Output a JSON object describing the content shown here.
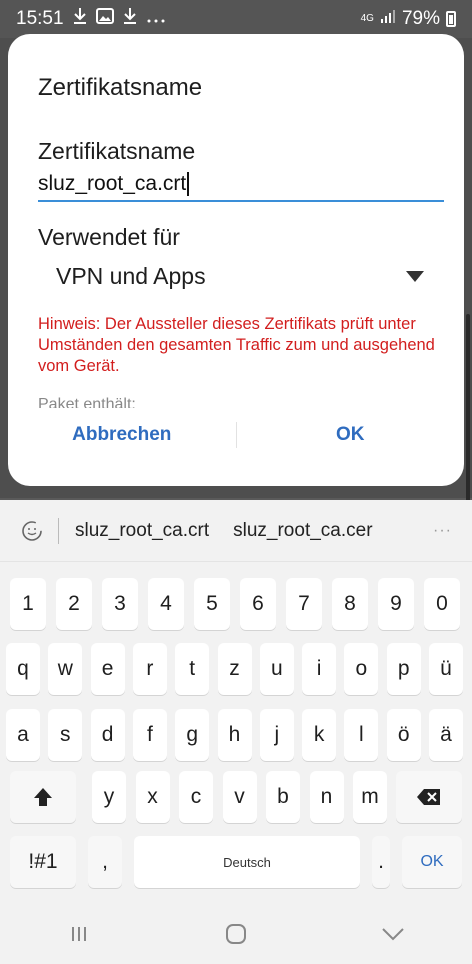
{
  "status_bar": {
    "time": "15:51",
    "network": "4G",
    "battery": "79%"
  },
  "dialog": {
    "title": "Zertifikatsname",
    "name_label": "Zertifikatsname",
    "name_value": "sluz_root_ca.crt",
    "used_for_label": "Verwendet für",
    "used_for_value": "VPN und Apps",
    "warning": "Hinweis: Der Aussteller dieses Zertifikats prüft unter Umständen den gesamten Traffic zum und ausgehend vom Gerät.",
    "package_label": "Paket enthält:",
    "cancel_label": "Abbrechen",
    "ok_label": "OK"
  },
  "keyboard": {
    "suggestions": [
      "sluz_root_ca.crt",
      "sluz_root_ca.cer"
    ],
    "more": "···",
    "row_numbers": [
      "1",
      "2",
      "3",
      "4",
      "5",
      "6",
      "7",
      "8",
      "9",
      "0"
    ],
    "row_q": [
      "q",
      "w",
      "e",
      "r",
      "t",
      "z",
      "u",
      "i",
      "o",
      "p",
      "ü"
    ],
    "row_a": [
      "a",
      "s",
      "d",
      "f",
      "g",
      "h",
      "j",
      "k",
      "l",
      "ö",
      "ä"
    ],
    "row_y": [
      "y",
      "x",
      "c",
      "v",
      "b",
      "n",
      "m"
    ],
    "symbols_label": "!#1",
    "comma": ",",
    "space_label": "Deutsch",
    "period": ".",
    "ok_label": "OK"
  },
  "colors": {
    "accent": "#2f6cbf",
    "warning": "#d21e1e",
    "input_underline": "#3a8ed8"
  }
}
